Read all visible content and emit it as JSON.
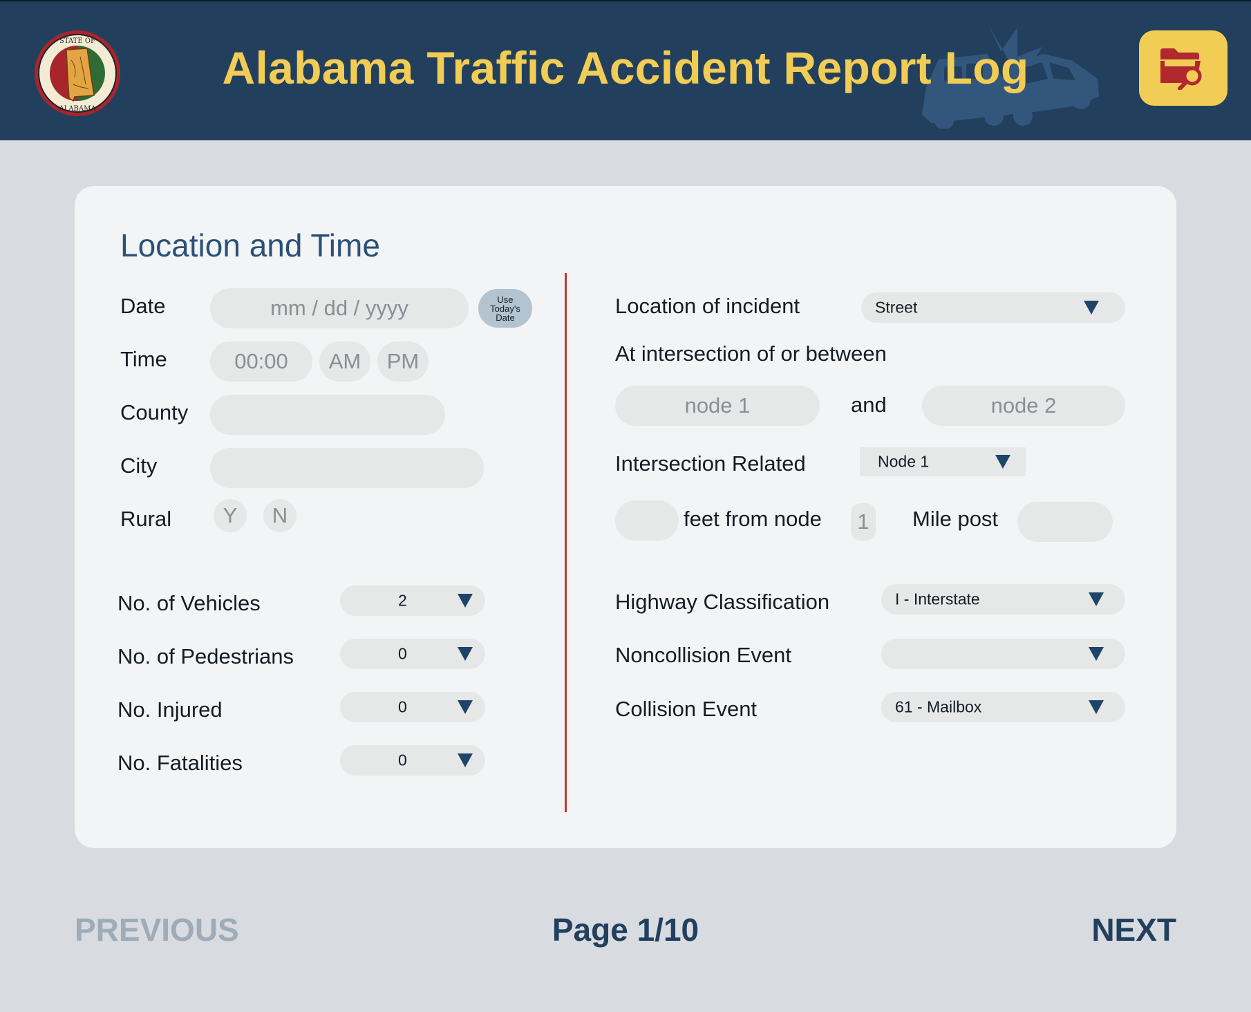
{
  "header": {
    "title": "Alabama Traffic Accident Report Log",
    "seal_text_top": "STATE OF",
    "seal_text_bottom": "ALABAMA",
    "seal_icon": "state-seal-icon",
    "search_icon": "folder-search-icon",
    "colors": {
      "bar": "#22405e",
      "title": "#f2cd55"
    }
  },
  "section": {
    "title": "Location and Time"
  },
  "left": {
    "date": {
      "label": "Date",
      "placeholder": "mm  /  dd  /  yyyy",
      "today_button": [
        "Use",
        "Today's",
        "Date"
      ]
    },
    "time": {
      "label": "Time",
      "placeholder": "00:00",
      "am": "AM",
      "pm": "PM"
    },
    "county": {
      "label": "County",
      "value": ""
    },
    "city": {
      "label": "City",
      "value": ""
    },
    "rural": {
      "label": "Rural",
      "yes": "Y",
      "no": "N"
    },
    "vehicles": {
      "label": "No. of Vehicles",
      "value": "2"
    },
    "pedestrians": {
      "label": "No. of Pedestrians",
      "value": "0"
    },
    "injured": {
      "label": "No. Injured",
      "value": "0"
    },
    "fatalities": {
      "label": "No. Fatalities",
      "value": "0"
    }
  },
  "right": {
    "location": {
      "label": "Location of incident",
      "value": "Street"
    },
    "intersection_heading": "At intersection of or between",
    "node1_placeholder": "node 1",
    "and": "and",
    "node2_placeholder": "node 2",
    "intersection_related": {
      "label": "Intersection Related",
      "value": "Node 1"
    },
    "feet_from_node": {
      "label": "feet from node",
      "node_value": "1"
    },
    "mile_post": {
      "label": "Mile post",
      "value": ""
    },
    "highway": {
      "label": "Highway Classification",
      "value": "I - Interstate"
    },
    "noncollision": {
      "label": "Noncollision Event",
      "value": ""
    },
    "collision": {
      "label": "Collision Event",
      "value": "61 - Mailbox"
    }
  },
  "footer": {
    "previous": "PREVIOUS",
    "page": "Page 1/10",
    "next": "NEXT"
  }
}
